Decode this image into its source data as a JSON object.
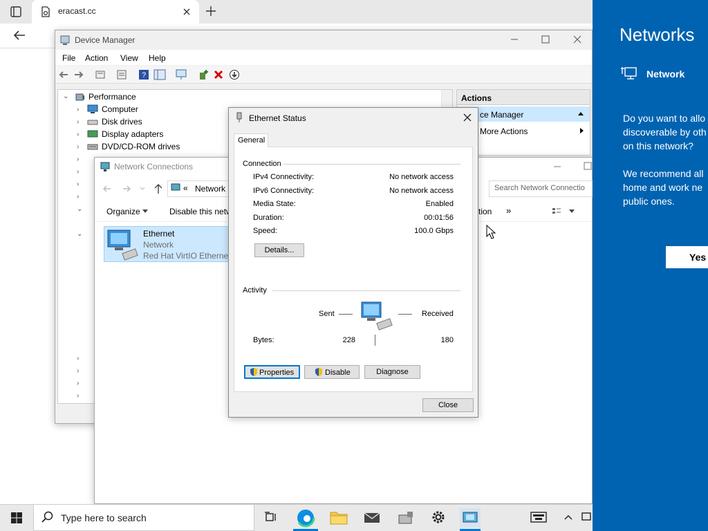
{
  "browser": {
    "tab_title": "eracast.cc"
  },
  "device_manager": {
    "title": "Device Manager",
    "menu": [
      "File",
      "Action",
      "View",
      "Help"
    ],
    "tree": [
      "Performance",
      "Computer",
      "Disk drives",
      "Display adapters",
      "DVD/CD-ROM drives"
    ],
    "actions": {
      "header": "Actions",
      "selected": "ce Manager",
      "more": "More Actions"
    }
  },
  "network_connections": {
    "title": "Network Connections",
    "breadcrumb_prefix": "«",
    "breadcrumb": "Network",
    "search_placeholder": "Search Network Connectio",
    "toolbar": {
      "organize": "Organize",
      "disable": "Disable this netw",
      "partial": "tion",
      "more": "»"
    },
    "adapter": {
      "name": "Ethernet",
      "network": "Network",
      "driver": "Red Hat VirtIO Ethernet"
    }
  },
  "ethernet_status": {
    "title": "Ethernet Status",
    "tab": "General",
    "connection_header": "Connection",
    "rows": [
      {
        "label": "IPv4 Connectivity:",
        "value": "No network access"
      },
      {
        "label": "IPv6 Connectivity:",
        "value": "No network access"
      },
      {
        "label": "Media State:",
        "value": "Enabled"
      },
      {
        "label": "Duration:",
        "value": "00:01:56"
      },
      {
        "label": "Speed:",
        "value": "100.0 Gbps"
      }
    ],
    "details_button": "Details...",
    "activity_header": "Activity",
    "sent_label": "Sent",
    "received_label": "Received",
    "bytes_label": "Bytes:",
    "bytes_sent": "228",
    "bytes_received": "180",
    "properties_button": "Properties",
    "disable_button": "Disable",
    "diagnose_button": "Diagnose",
    "close_button": "Close"
  },
  "flyout": {
    "title": "Networks",
    "network_name": "Network",
    "question": [
      "Do you want to allo",
      "discoverable by oth",
      "on this network?"
    ],
    "recommend": [
      "We recommend all",
      "home and work ne",
      "public ones."
    ],
    "yes_button": "Yes"
  },
  "taskbar": {
    "search_placeholder": "Type here to search"
  },
  "colors": {
    "flyout_bg": "#0063b1",
    "selection": "#cce8ff",
    "accent": "#0078d7"
  }
}
